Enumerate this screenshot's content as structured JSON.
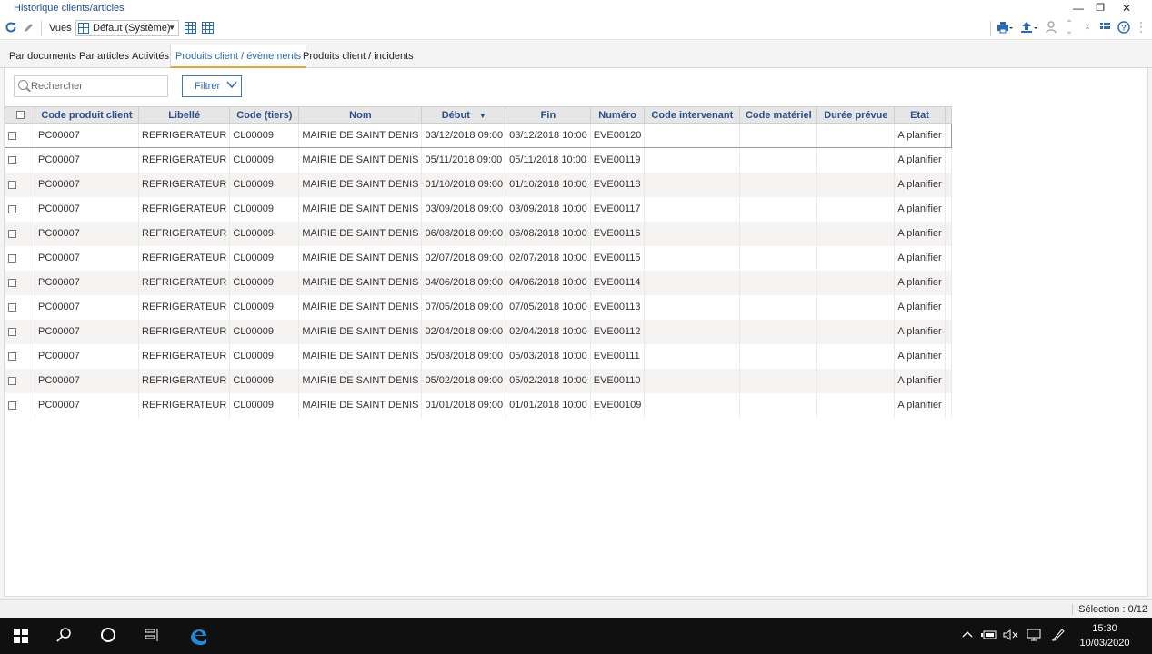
{
  "window": {
    "title": "Historique clients/articles",
    "minimize": "—",
    "restore": "❐",
    "close": "✕"
  },
  "toolbar": {
    "vues_label": "Vues",
    "view_selected": "Défaut (Système)",
    "icons": [
      "refresh-icon",
      "pencil-icon",
      "print-icon",
      "export-icon",
      "user-icon",
      "collapse-icon",
      "expand-icon",
      "apps-icon",
      "help-icon",
      "more-icon"
    ]
  },
  "tabs": [
    {
      "label": "Par documents",
      "active": false
    },
    {
      "label": "Par articles",
      "active": false
    },
    {
      "label": "Activités",
      "active": false
    },
    {
      "label": "Produits client / évènements",
      "active": true
    },
    {
      "label": "Produits client / incidents",
      "active": false
    }
  ],
  "search": {
    "placeholder": "Rechercher",
    "value": ""
  },
  "filter": {
    "label": "Filtrer"
  },
  "table": {
    "columns": [
      "Code produit client",
      "Libellé",
      "Code (tiers)",
      "Nom",
      "Début",
      "Fin",
      "Numéro",
      "Code intervenant",
      "Code matériel",
      "Durée prévue",
      "Etat"
    ],
    "sorted_column": "Début",
    "rows": [
      [
        "PC00007",
        "REFRIGERATEUR",
        "CL00009",
        "MAIRIE DE SAINT DENIS",
        "03/12/2018 09:00",
        "03/12/2018 10:00",
        "EVE00120",
        "",
        "",
        "",
        "A planifier"
      ],
      [
        "PC00007",
        "REFRIGERATEUR",
        "CL00009",
        "MAIRIE DE SAINT DENIS",
        "05/11/2018 09:00",
        "05/11/2018 10:00",
        "EVE00119",
        "",
        "",
        "",
        "A planifier"
      ],
      [
        "PC00007",
        "REFRIGERATEUR",
        "CL00009",
        "MAIRIE DE SAINT DENIS",
        "01/10/2018 09:00",
        "01/10/2018 10:00",
        "EVE00118",
        "",
        "",
        "",
        "A planifier"
      ],
      [
        "PC00007",
        "REFRIGERATEUR",
        "CL00009",
        "MAIRIE DE SAINT DENIS",
        "03/09/2018 09:00",
        "03/09/2018 10:00",
        "EVE00117",
        "",
        "",
        "",
        "A planifier"
      ],
      [
        "PC00007",
        "REFRIGERATEUR",
        "CL00009",
        "MAIRIE DE SAINT DENIS",
        "06/08/2018 09:00",
        "06/08/2018 10:00",
        "EVE00116",
        "",
        "",
        "",
        "A planifier"
      ],
      [
        "PC00007",
        "REFRIGERATEUR",
        "CL00009",
        "MAIRIE DE SAINT DENIS",
        "02/07/2018 09:00",
        "02/07/2018 10:00",
        "EVE00115",
        "",
        "",
        "",
        "A planifier"
      ],
      [
        "PC00007",
        "REFRIGERATEUR",
        "CL00009",
        "MAIRIE DE SAINT DENIS",
        "04/06/2018 09:00",
        "04/06/2018 10:00",
        "EVE00114",
        "",
        "",
        "",
        "A planifier"
      ],
      [
        "PC00007",
        "REFRIGERATEUR",
        "CL00009",
        "MAIRIE DE SAINT DENIS",
        "07/05/2018 09:00",
        "07/05/2018 10:00",
        "EVE00113",
        "",
        "",
        "",
        "A planifier"
      ],
      [
        "PC00007",
        "REFRIGERATEUR",
        "CL00009",
        "MAIRIE DE SAINT DENIS",
        "02/04/2018 09:00",
        "02/04/2018 10:00",
        "EVE00112",
        "",
        "",
        "",
        "A planifier"
      ],
      [
        "PC00007",
        "REFRIGERATEUR",
        "CL00009",
        "MAIRIE DE SAINT DENIS",
        "05/03/2018 09:00",
        "05/03/2018 10:00",
        "EVE00111",
        "",
        "",
        "",
        "A planifier"
      ],
      [
        "PC00007",
        "REFRIGERATEUR",
        "CL00009",
        "MAIRIE DE SAINT DENIS",
        "05/02/2018 09:00",
        "05/02/2018 10:00",
        "EVE00110",
        "",
        "",
        "",
        "A planifier"
      ],
      [
        "PC00007",
        "REFRIGERATEUR",
        "CL00009",
        "MAIRIE DE SAINT DENIS",
        "01/01/2018 09:00",
        "01/01/2018 10:00",
        "EVE00109",
        "",
        "",
        "",
        "A planifier"
      ]
    ]
  },
  "status": {
    "selection": "Sélection : 0/12"
  },
  "taskbar": {
    "time": "15:30",
    "date": "10/03/2020"
  }
}
